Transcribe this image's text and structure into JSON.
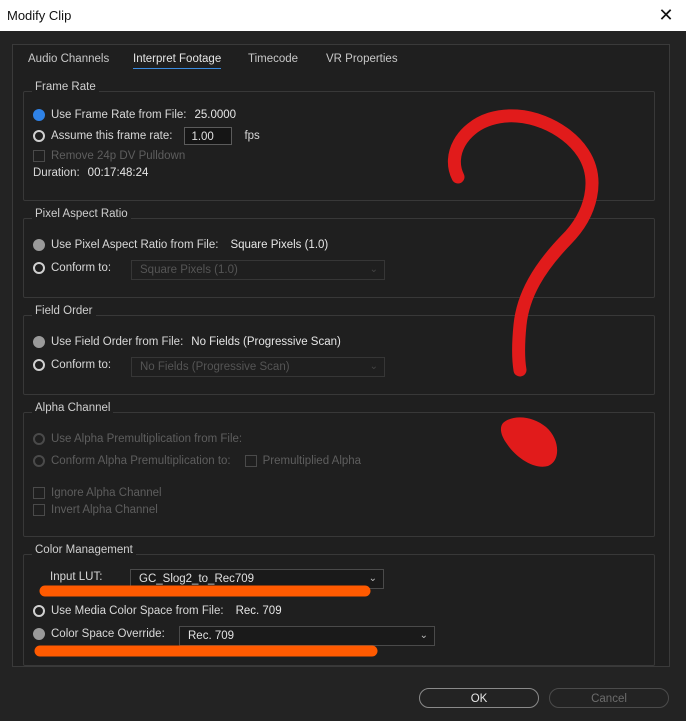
{
  "window": {
    "title": "Modify Clip",
    "close_glyph": "✕"
  },
  "tabs": [
    {
      "label": "Audio Channels"
    },
    {
      "label": "Interpret Footage"
    },
    {
      "label": "Timecode"
    },
    {
      "label": "VR Properties"
    }
  ],
  "frame_rate": {
    "title": "Frame Rate",
    "use_from_file_label": "Use Frame Rate from File:",
    "use_from_file_value": "25.0000",
    "assume_label": "Assume this frame rate:",
    "assume_value": "1.00",
    "fps_label": "fps",
    "remove_pulldown_label": "Remove 24p DV Pulldown",
    "duration_label": "Duration:",
    "duration_value": "00:17:48:24"
  },
  "pixel_aspect": {
    "title": "Pixel Aspect Ratio",
    "use_from_file_label": "Use Pixel Aspect Ratio from File:",
    "use_from_file_value": "Square Pixels (1.0)",
    "conform_label": "Conform to:",
    "conform_value": "Square Pixels (1.0)"
  },
  "field_order": {
    "title": "Field Order",
    "use_from_file_label": "Use Field Order from File:",
    "use_from_file_value": "No Fields (Progressive Scan)",
    "conform_label": "Conform to:",
    "conform_value": "No Fields (Progressive Scan)"
  },
  "alpha": {
    "title": "Alpha Channel",
    "use_premult_label": "Use Alpha Premultiplication from File:",
    "conform_premult_label": "Conform Alpha Premultiplication to:",
    "premultiplied_label": "Premultiplied Alpha",
    "ignore_label": "Ignore Alpha Channel",
    "invert_label": "Invert Alpha Channel"
  },
  "color_mgmt": {
    "title": "Color Management",
    "input_lut_label": "Input LUT:",
    "input_lut_value": "GC_Slog2_to_Rec709",
    "media_space_label": "Use Media Color Space from File:",
    "media_space_value": "Rec. 709",
    "override_label": "Color Space Override:",
    "override_value": "Rec. 709"
  },
  "buttons": {
    "ok": "OK",
    "cancel": "Cancel"
  },
  "colors": {
    "annotation_red": "#e11b1b",
    "annotation_orange": "#ff5a00",
    "accent_blue": "#2f82e6"
  }
}
